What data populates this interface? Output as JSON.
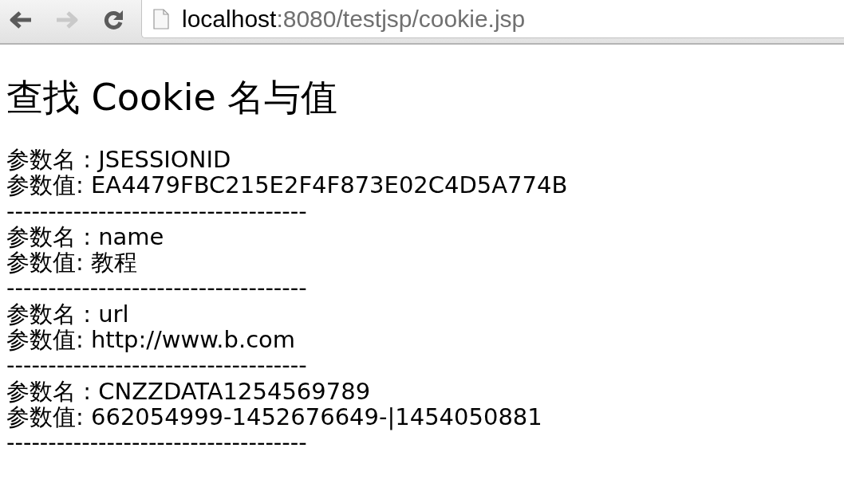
{
  "browser": {
    "nav_buttons": [
      {
        "kind": "back",
        "disabled": false
      },
      {
        "kind": "forward",
        "disabled": true
      },
      {
        "kind": "reload",
        "disabled": false
      }
    ],
    "address": {
      "host": "localhost",
      "path": ":8080/testjsp/cookie.jsp"
    }
  },
  "page": {
    "heading": "查找 Cookie 名与值",
    "cookies": [
      {
        "name_line": "参数名 : JSESSIONID",
        "value_line": "参数值: EA4479FBC215E2F4F873E02C4D5A774B",
        "separator": "------------------------------------"
      },
      {
        "name_line": "参数名 : name",
        "value_line": "参数值: 教程",
        "separator": "------------------------------------"
      },
      {
        "name_line": "参数名 : url",
        "value_line": "参数值: http://www.b.com",
        "separator": "------------------------------------"
      },
      {
        "name_line": "参数名 : CNZZDATA1254569789",
        "value_line": "参数值: 662054999-1452676649-|1454050881",
        "separator": "------------------------------------"
      }
    ]
  }
}
